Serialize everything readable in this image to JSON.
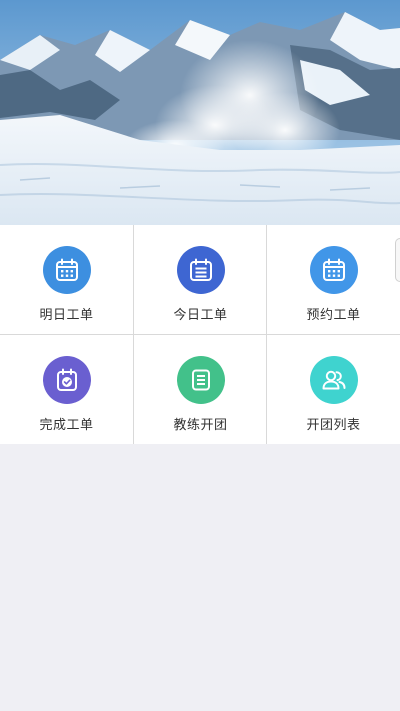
{
  "banner": {
    "image_name": "snowy-mountain-avalanche-banner"
  },
  "menu": {
    "items": [
      {
        "label": "明日工单",
        "icon": "calendar-icon",
        "color": "#3d8fe0"
      },
      {
        "label": "今日工单",
        "icon": "list-calendar-icon",
        "color": "#3e66d2"
      },
      {
        "label": "预约工单",
        "icon": "calendar-icon",
        "color": "#4196e8"
      },
      {
        "label": "完成工单",
        "icon": "calendar-check-icon",
        "color": "#6a5fd0"
      },
      {
        "label": "教练开团",
        "icon": "document-list-icon",
        "color": "#42c18a"
      },
      {
        "label": "开团列表",
        "icon": "group-users-icon",
        "color": "#3fd3cf"
      }
    ]
  }
}
